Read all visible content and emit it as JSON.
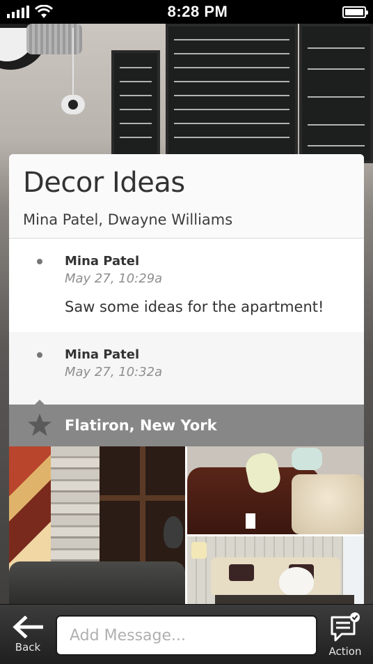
{
  "status_bar": {
    "time": "8:28 PM",
    "signal_icon": "signal-bars-icon",
    "wifi_icon": "wifi-icon",
    "battery_icon": "battery-icon"
  },
  "conversation": {
    "title": "Decor Ideas",
    "participants": "Mina Patel, Dwayne Williams"
  },
  "messages": [
    {
      "author": "Mina Patel",
      "time": "May 27, 10:29a",
      "text": "Saw some ideas for the apartment!"
    },
    {
      "author": "Mina Patel",
      "time": "May 27, 10:32a"
    }
  ],
  "location": {
    "icon": "star-icon",
    "label": "Flatiron, New York"
  },
  "photos": [
    "living-room-shelf-photo",
    "leather-sofa-photo",
    "cream-sofa-photo"
  ],
  "bottom_bar": {
    "back_label": "Back",
    "message_placeholder": "Add Message...",
    "action_label": "Action"
  },
  "colors": {
    "location_bar": "#878787",
    "status_bar": "#000000",
    "bottom_bar": "#2a2a2a"
  }
}
